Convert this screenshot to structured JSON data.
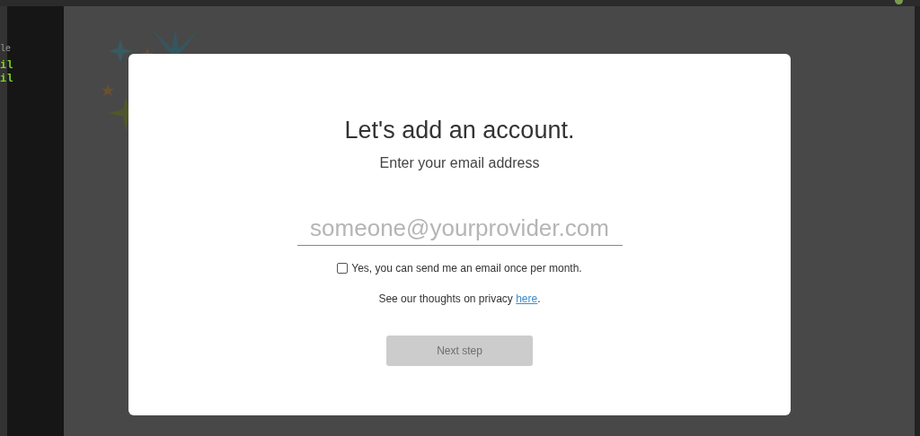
{
  "terminal": {
    "lines": [
      "le",
      "il",
      "il"
    ]
  },
  "dialog": {
    "title": "Let's add an account.",
    "subtitle": "Enter your email address",
    "email_field": {
      "placeholder": "someone@yourprovider.com"
    },
    "newsletter": {
      "label": "Yes, you can send me an email once per month.",
      "checked": false
    },
    "privacy": {
      "text": "See our thoughts on privacy ",
      "link": "here",
      "after": "."
    },
    "next_button": {
      "label": "Next step",
      "disabled": true
    }
  }
}
